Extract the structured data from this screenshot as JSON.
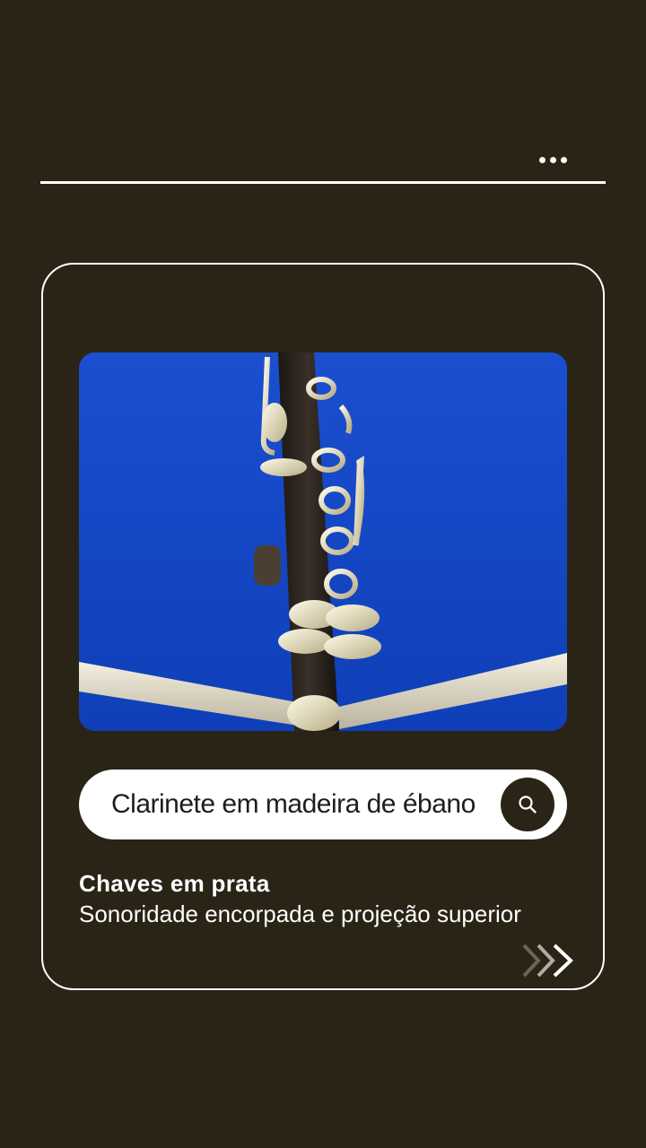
{
  "header": {
    "menu_icon": "more-horizontal-icon"
  },
  "card": {
    "image": {
      "subject": "clarinet-photo"
    },
    "search": {
      "value": "Clarinete em madeira de ébano",
      "button_icon": "search-icon"
    },
    "title": "Chaves em prata",
    "subtitle": "Sonoridade encorpada e projeção superior",
    "next_icon": "triple-chevron-right-icon"
  },
  "colors": {
    "background": "#2a2417",
    "foreground": "#ffffff",
    "sky": "#1447c4"
  }
}
